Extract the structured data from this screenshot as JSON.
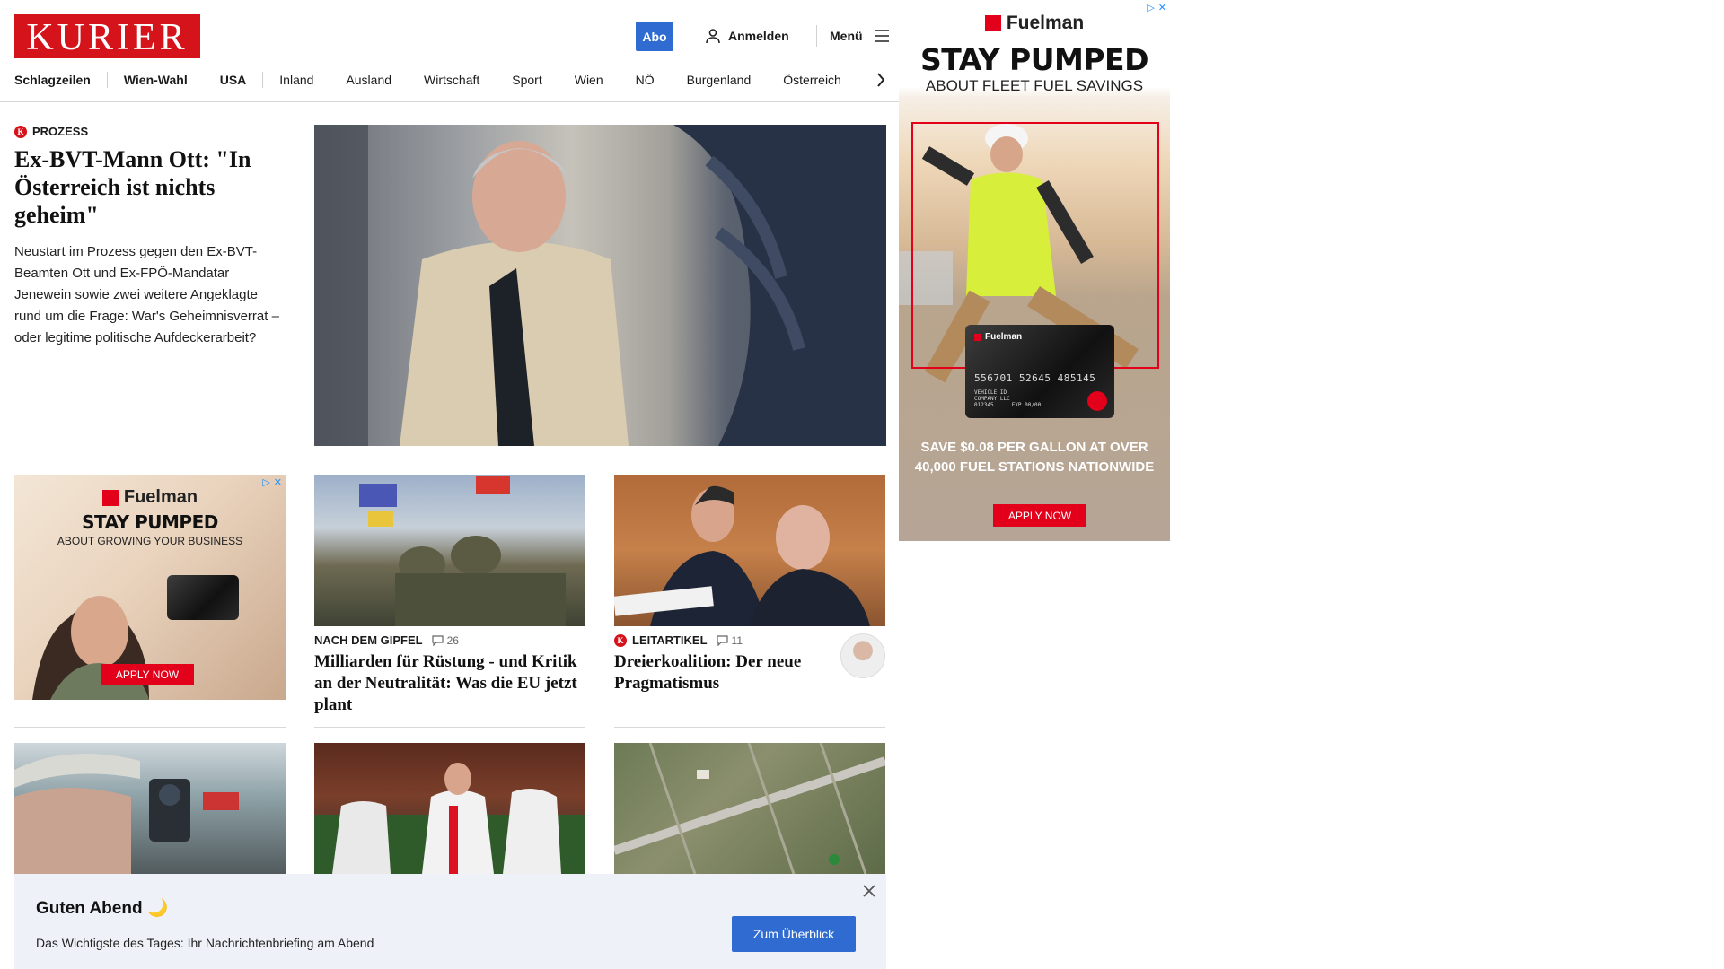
{
  "header": {
    "logo": "KURIER",
    "abo_label": "Abo",
    "login_label": "Anmelden",
    "menu_label": "Menü",
    "icons": {
      "user": "user-icon",
      "menu": "hamburger-menu-icon",
      "next": "chevron-right-icon"
    }
  },
  "nav": {
    "items": [
      "Schlagzeilen",
      "Wien-Wahl",
      "USA",
      "Inland",
      "Ausland",
      "Wirtschaft",
      "Sport",
      "Wien",
      "NÖ",
      "Burgenland",
      "Österreich"
    ]
  },
  "hero": {
    "kicker": "Prozess",
    "title": "Ex-BVT-Mann Ott: \"In Österreich ist nichts geheim\"",
    "lead": "Neustart im Prozess gegen den Ex-BVT-Beamten Ott und Ex-FPÖ-Mandatar Jenewein sowie zwei weitere Angeklagte rund um die Frage: War's Geheimnisverrat – oder legitime politische Aufdeckerarbeit?"
  },
  "articles": [
    {
      "kicker": "Nach dem Gipfel",
      "comments": "26",
      "title": "Milliarden für Rüstung - und Kritik an der Neutralität: Was die EU jetzt plant"
    },
    {
      "kicker": "Leitartikel",
      "comments": "11",
      "title": "Dreierkoalition: Der neue Pragmatismus"
    }
  ],
  "ad_small": {
    "brand": "Fuelman",
    "headline": "STAY PUMPED",
    "sub": "ABOUT GROWING YOUR BUSINESS",
    "cta": "APPLY NOW"
  },
  "ad_right": {
    "brand": "Fuelman",
    "headline": "STAY PUMPED",
    "sub": "ABOUT FLEET FUEL SAVINGS",
    "card_brand": "Fuelman",
    "card_number": "556701 52645 485145",
    "card_line1": "VEHICLE ID",
    "card_line2": "COMPANY LLC",
    "card_line3": "012345",
    "card_exp": "EXP 00/00",
    "promo": "SAVE $0.08 PER GALLON AT OVER 40,000 FUEL STATIONS NATIONWIDE",
    "cta": "APPLY NOW"
  },
  "notification": {
    "title": "Guten Abend 🌙",
    "text": "Das Wichtigste des Tages: Ihr Nachrichtenbriefing am Abend",
    "button": "Zum Überblick"
  },
  "colors": {
    "brand_red": "#d5131a",
    "button_blue": "#2f6bd1",
    "ad_red": "#e2001a"
  }
}
